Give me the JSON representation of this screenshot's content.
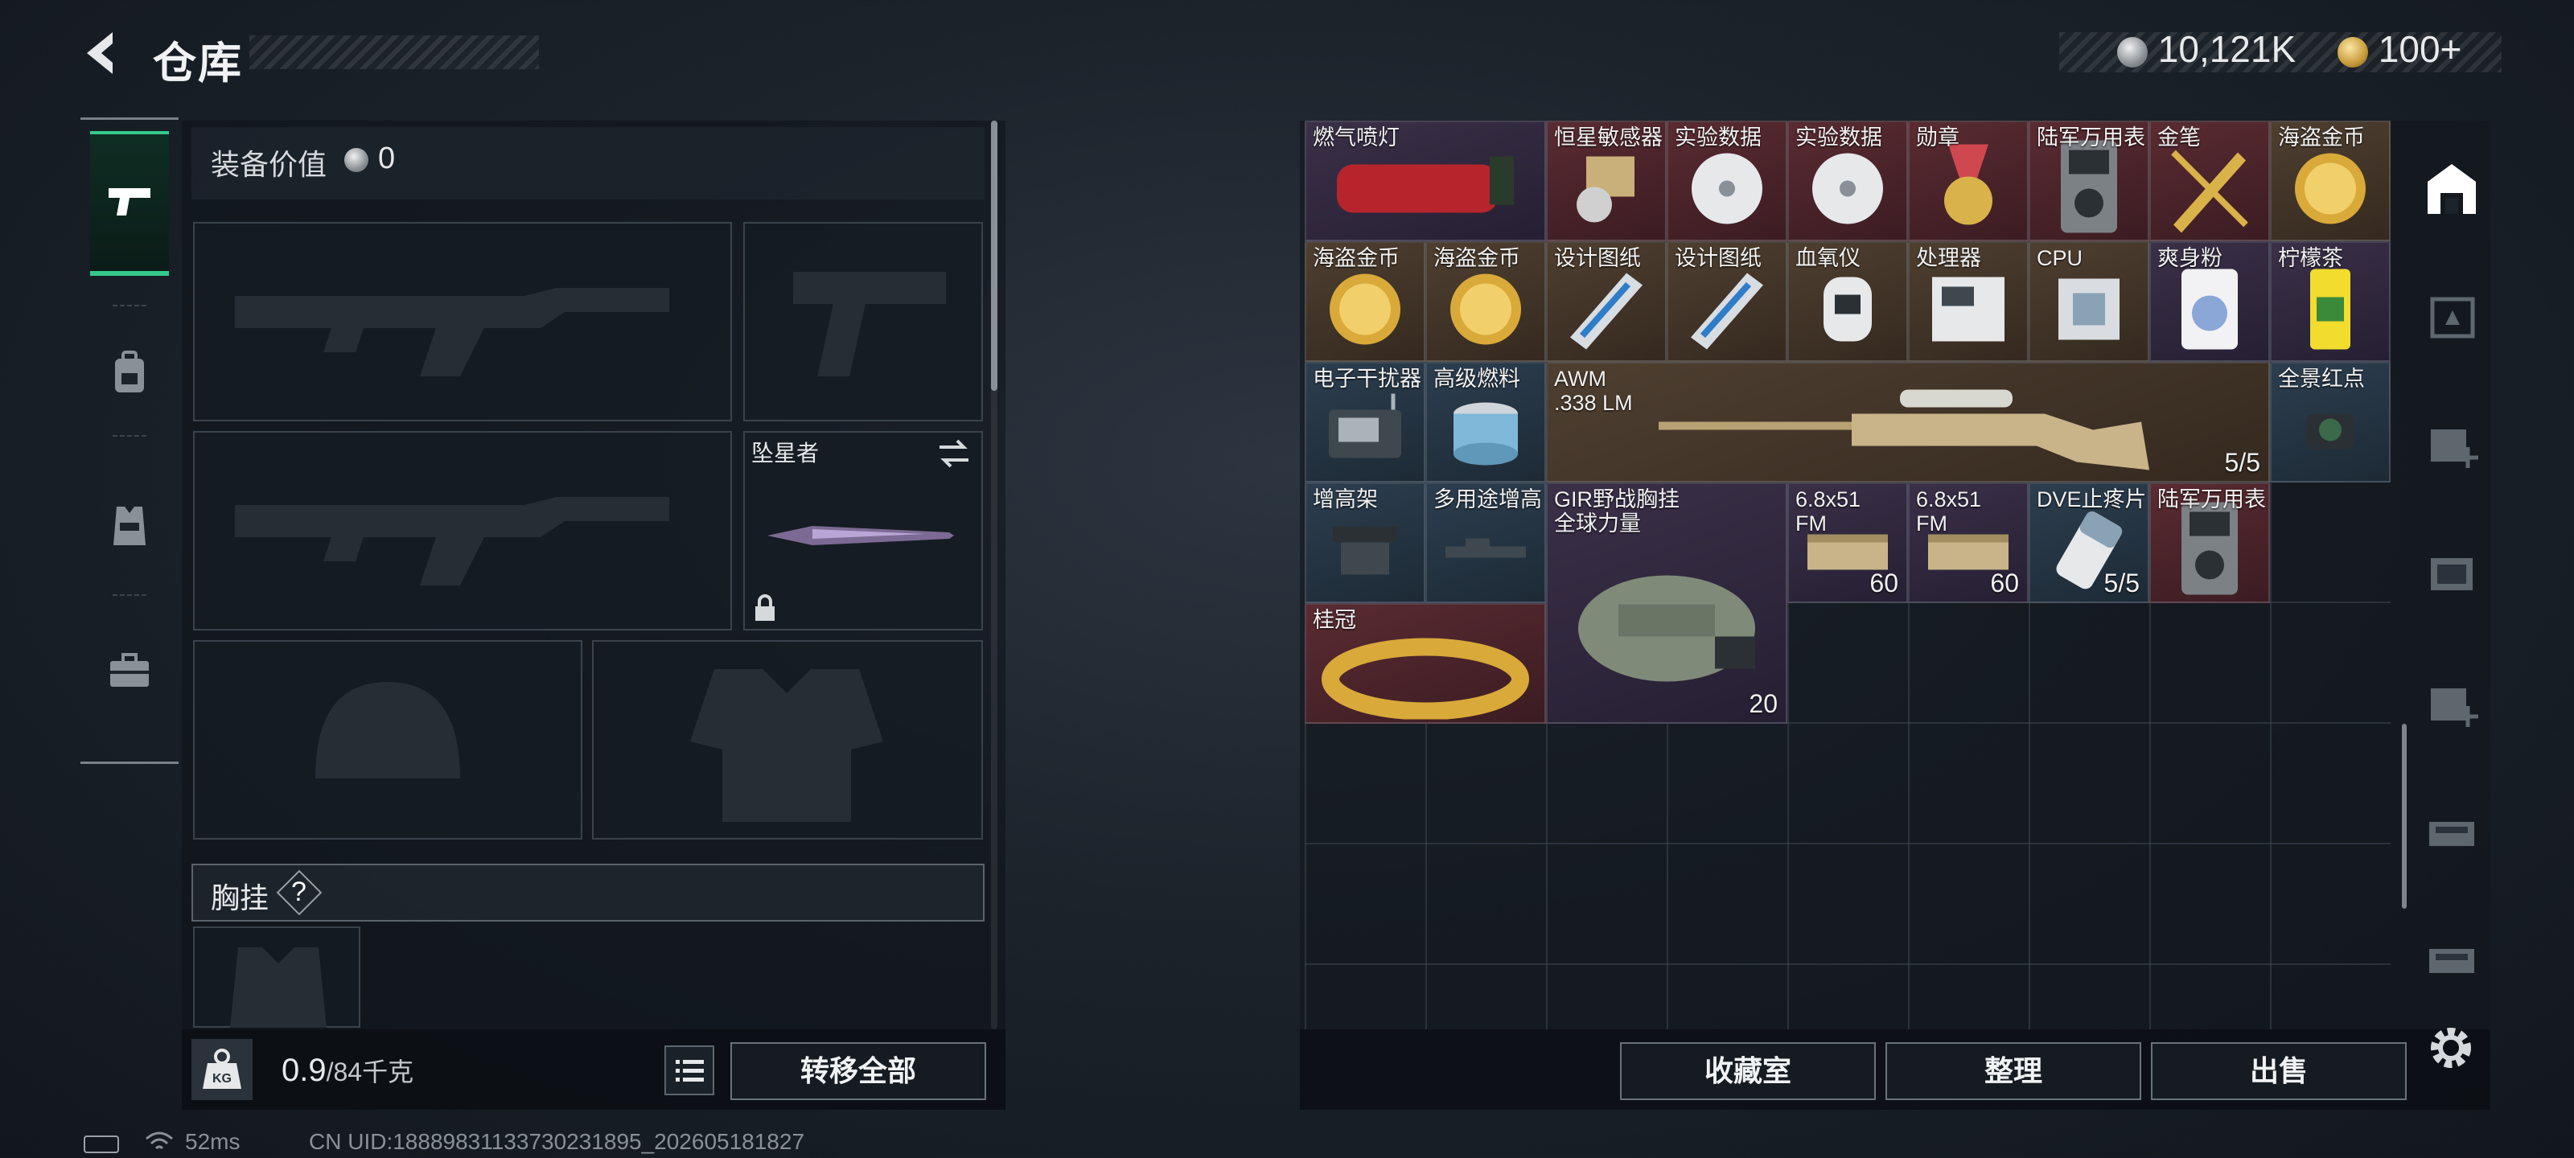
{
  "header": {
    "title": "仓库",
    "currency_silver": "10,121K",
    "currency_gold": "100+"
  },
  "left_tabs": [
    {
      "name": "weapons",
      "icon": "pistol-icon",
      "active": true
    },
    {
      "name": "backpack",
      "icon": "backpack-icon",
      "active": false
    },
    {
      "name": "armor",
      "icon": "vest-icon",
      "active": false
    },
    {
      "name": "case",
      "icon": "briefcase-icon",
      "active": false
    }
  ],
  "equipment": {
    "label": "装备价值",
    "value": "0",
    "melee_name": "坠星者",
    "chest_label": "胸挂",
    "chest_help": "?"
  },
  "left_bottom": {
    "weight_current": "0.9",
    "weight_max": "/84千克",
    "transfer_all": "转移全部"
  },
  "items": [
    {
      "name": "",
      "rarity": "red",
      "icon": "coffee-bag-icon"
    },
    {
      "name": "",
      "rarity": "red",
      "icon": "coffee-bag-icon"
    },
    {
      "name": "",
      "rarity": "gold",
      "icon": "box-icon"
    },
    {
      "name": "",
      "rarity": "gold",
      "icon": "figurine-icon"
    },
    {
      "name": "",
      "rarity": "red",
      "icon": "bag-icon"
    },
    {
      "name": "燃气喷灯",
      "rarity": "purple",
      "icon": "torch-icon"
    },
    {
      "name": "恒星敏感器",
      "rarity": "red",
      "icon": "sensor-icon"
    },
    {
      "name": "实验数据",
      "rarity": "red",
      "icon": "disc-icon"
    },
    {
      "name": "实验数据",
      "rarity": "red",
      "icon": "disc-icon"
    },
    {
      "name": "勋章",
      "rarity": "red",
      "icon": "medal-icon"
    },
    {
      "name": "陆军万用表",
      "rarity": "red",
      "icon": "multimeter-icon"
    },
    {
      "name": "金笔",
      "rarity": "red",
      "icon": "pen-icon"
    },
    {
      "name": "海盗金币",
      "rarity": "gold",
      "icon": "gold-coin-icon"
    },
    {
      "name": "海盗金币",
      "rarity": "gold",
      "icon": "gold-coin-icon"
    },
    {
      "name": "海盗金币",
      "rarity": "gold",
      "icon": "gold-coin-icon"
    },
    {
      "name": "设计图纸",
      "rarity": "gold",
      "icon": "blueprint-icon"
    },
    {
      "name": "设计图纸",
      "rarity": "gold",
      "icon": "blueprint-icon"
    },
    {
      "name": "血氧仪",
      "rarity": "gold",
      "icon": "oximeter-icon"
    },
    {
      "name": "处理器",
      "rarity": "gold",
      "icon": "processor-icon"
    },
    {
      "name": "CPU",
      "rarity": "gold",
      "icon": "cpu-icon"
    },
    {
      "name": "爽身粉",
      "rarity": "purple",
      "icon": "powder-icon"
    },
    {
      "name": "柠檬茶",
      "rarity": "purple",
      "icon": "tea-can-icon"
    },
    {
      "name": "电子干扰器",
      "rarity": "blue",
      "icon": "jammer-icon"
    },
    {
      "name": "高级燃料",
      "rarity": "blue",
      "icon": "fuel-can-icon"
    },
    {
      "name": "AWM\n.338 LM",
      "rarity": "gold",
      "icon": "sniper-rifle-icon",
      "qty": "5/5"
    },
    {
      "name": "全景红点",
      "rarity": "blue",
      "icon": "red-dot-sight-icon"
    },
    {
      "name": "增高架",
      "rarity": "blue",
      "icon": "riser-mount-icon"
    },
    {
      "name": "多用途增高",
      "rarity": "blue",
      "icon": "rail-mount-icon"
    },
    {
      "name": "GIR野战胸挂\n全球力量",
      "rarity": "purple",
      "icon": "chest-rig-icon",
      "qty": "20"
    },
    {
      "name": "6.8x51\nFM",
      "rarity": "purple",
      "icon": "ammo-box-icon",
      "qty": "60"
    },
    {
      "name": "6.8x51\nFM",
      "rarity": "purple",
      "icon": "ammo-box-icon",
      "qty": "60"
    },
    {
      "name": "DVE止疼片",
      "rarity": "blue",
      "icon": "painkiller-icon",
      "qty": "5/5"
    },
    {
      "name": "陆军万用表",
      "rarity": "red",
      "icon": "multimeter-icon"
    },
    {
      "name": "桂冠",
      "rarity": "red",
      "icon": "laurel-crown-icon"
    }
  ],
  "grid_buttons": {
    "collection": "收藏室",
    "organize": "整理",
    "sell": "出售"
  },
  "status": {
    "ping": "52ms",
    "uid": "CN UID:1888983113373023189​5_202605181827"
  },
  "colors": {
    "accent": "#35c98c",
    "red_rarity": "#5a2b32",
    "gold_rarity": "#4e3f30",
    "purple_rarity": "#3a3048",
    "blue_rarity": "#2c3e4f"
  }
}
